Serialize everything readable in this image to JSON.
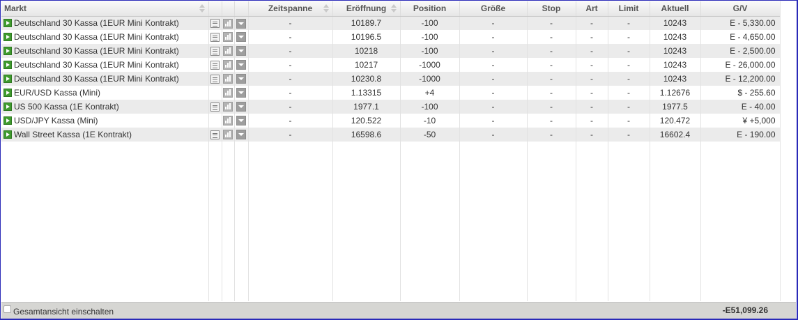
{
  "columns": {
    "markt": "Markt",
    "zeitspanne": "Zeitspanne",
    "eroeffnung": "Eröffnung",
    "position": "Position",
    "groesse": "Größe",
    "stop": "Stop",
    "art": "Art",
    "limit": "Limit",
    "aktuell": "Aktuell",
    "gv": "G/V"
  },
  "rows": [
    {
      "market": "Deutschland 30 Kassa (1EUR Mini Kontrakt)",
      "has_doc": true,
      "zeitspanne": "-",
      "eroeffnung": "10189.7",
      "position": "-100",
      "groesse": "-",
      "stop": "-",
      "art": "-",
      "limit": "-",
      "aktuell": "10243",
      "gv": "E - 5,330.00",
      "gv_sign": "neg",
      "pos_sign": "neg"
    },
    {
      "market": "Deutschland 30 Kassa (1EUR Mini Kontrakt)",
      "has_doc": true,
      "zeitspanne": "-",
      "eroeffnung": "10196.5",
      "position": "-100",
      "groesse": "-",
      "stop": "-",
      "art": "-",
      "limit": "-",
      "aktuell": "10243",
      "gv": "E - 4,650.00",
      "gv_sign": "neg",
      "pos_sign": "neg"
    },
    {
      "market": "Deutschland 30 Kassa (1EUR Mini Kontrakt)",
      "has_doc": true,
      "zeitspanne": "-",
      "eroeffnung": "10218",
      "position": "-100",
      "groesse": "-",
      "stop": "-",
      "art": "-",
      "limit": "-",
      "aktuell": "10243",
      "gv": "E - 2,500.00",
      "gv_sign": "neg",
      "pos_sign": "neg"
    },
    {
      "market": "Deutschland 30 Kassa (1EUR Mini Kontrakt)",
      "has_doc": true,
      "zeitspanne": "-",
      "eroeffnung": "10217",
      "position": "-1000",
      "groesse": "-",
      "stop": "-",
      "art": "-",
      "limit": "-",
      "aktuell": "10243",
      "gv": "E - 26,000.00",
      "gv_sign": "neg",
      "pos_sign": "neg"
    },
    {
      "market": "Deutschland 30 Kassa (1EUR Mini Kontrakt)",
      "has_doc": true,
      "zeitspanne": "-",
      "eroeffnung": "10230.8",
      "position": "-1000",
      "groesse": "-",
      "stop": "-",
      "art": "-",
      "limit": "-",
      "aktuell": "10243",
      "gv": "E - 12,200.00",
      "gv_sign": "neg",
      "pos_sign": "neg"
    },
    {
      "market": "EUR/USD Kassa (Mini)",
      "has_doc": false,
      "zeitspanne": "-",
      "eroeffnung": "1.13315",
      "position": "+4",
      "groesse": "-",
      "stop": "-",
      "art": "-",
      "limit": "-",
      "aktuell": "1.12676",
      "gv": "$ - 255.60",
      "gv_sign": "neg",
      "pos_sign": "pos"
    },
    {
      "market": "US 500 Kassa (1E Kontrakt)",
      "has_doc": true,
      "zeitspanne": "-",
      "eroeffnung": "1977.1",
      "position": "-100",
      "groesse": "-",
      "stop": "-",
      "art": "-",
      "limit": "-",
      "aktuell": "1977.5",
      "gv": "E - 40.00",
      "gv_sign": "neg",
      "pos_sign": "neg"
    },
    {
      "market": "USD/JPY Kassa (Mini)",
      "has_doc": false,
      "zeitspanne": "-",
      "eroeffnung": "120.522",
      "position": "-10",
      "groesse": "-",
      "stop": "-",
      "art": "-",
      "limit": "-",
      "aktuell": "120.472",
      "gv": "¥ +5,000",
      "gv_sign": "pos",
      "pos_sign": "neg"
    },
    {
      "market": "Wall Street Kassa (1E Kontrakt)",
      "has_doc": true,
      "zeitspanne": "-",
      "eroeffnung": "16598.6",
      "position": "-50",
      "groesse": "-",
      "stop": "-",
      "art": "-",
      "limit": "-",
      "aktuell": "16602.4",
      "gv": "E - 190.00",
      "gv_sign": "neg",
      "pos_sign": "neg"
    }
  ],
  "footer": {
    "toggle_label": "Gesamtansicht einschalten",
    "total": "-E51,099.26"
  },
  "colors": {
    "negative": "#d42a2a",
    "positive": "#1f8fd6",
    "play_icon": "#3f9a2e",
    "frame_border": "#2a2ab8"
  },
  "icons": {
    "row_expand": "play-icon",
    "details": "doc-icon",
    "chart": "chart-icon",
    "menu": "dropdown-icon",
    "sort": "sort-icon"
  }
}
